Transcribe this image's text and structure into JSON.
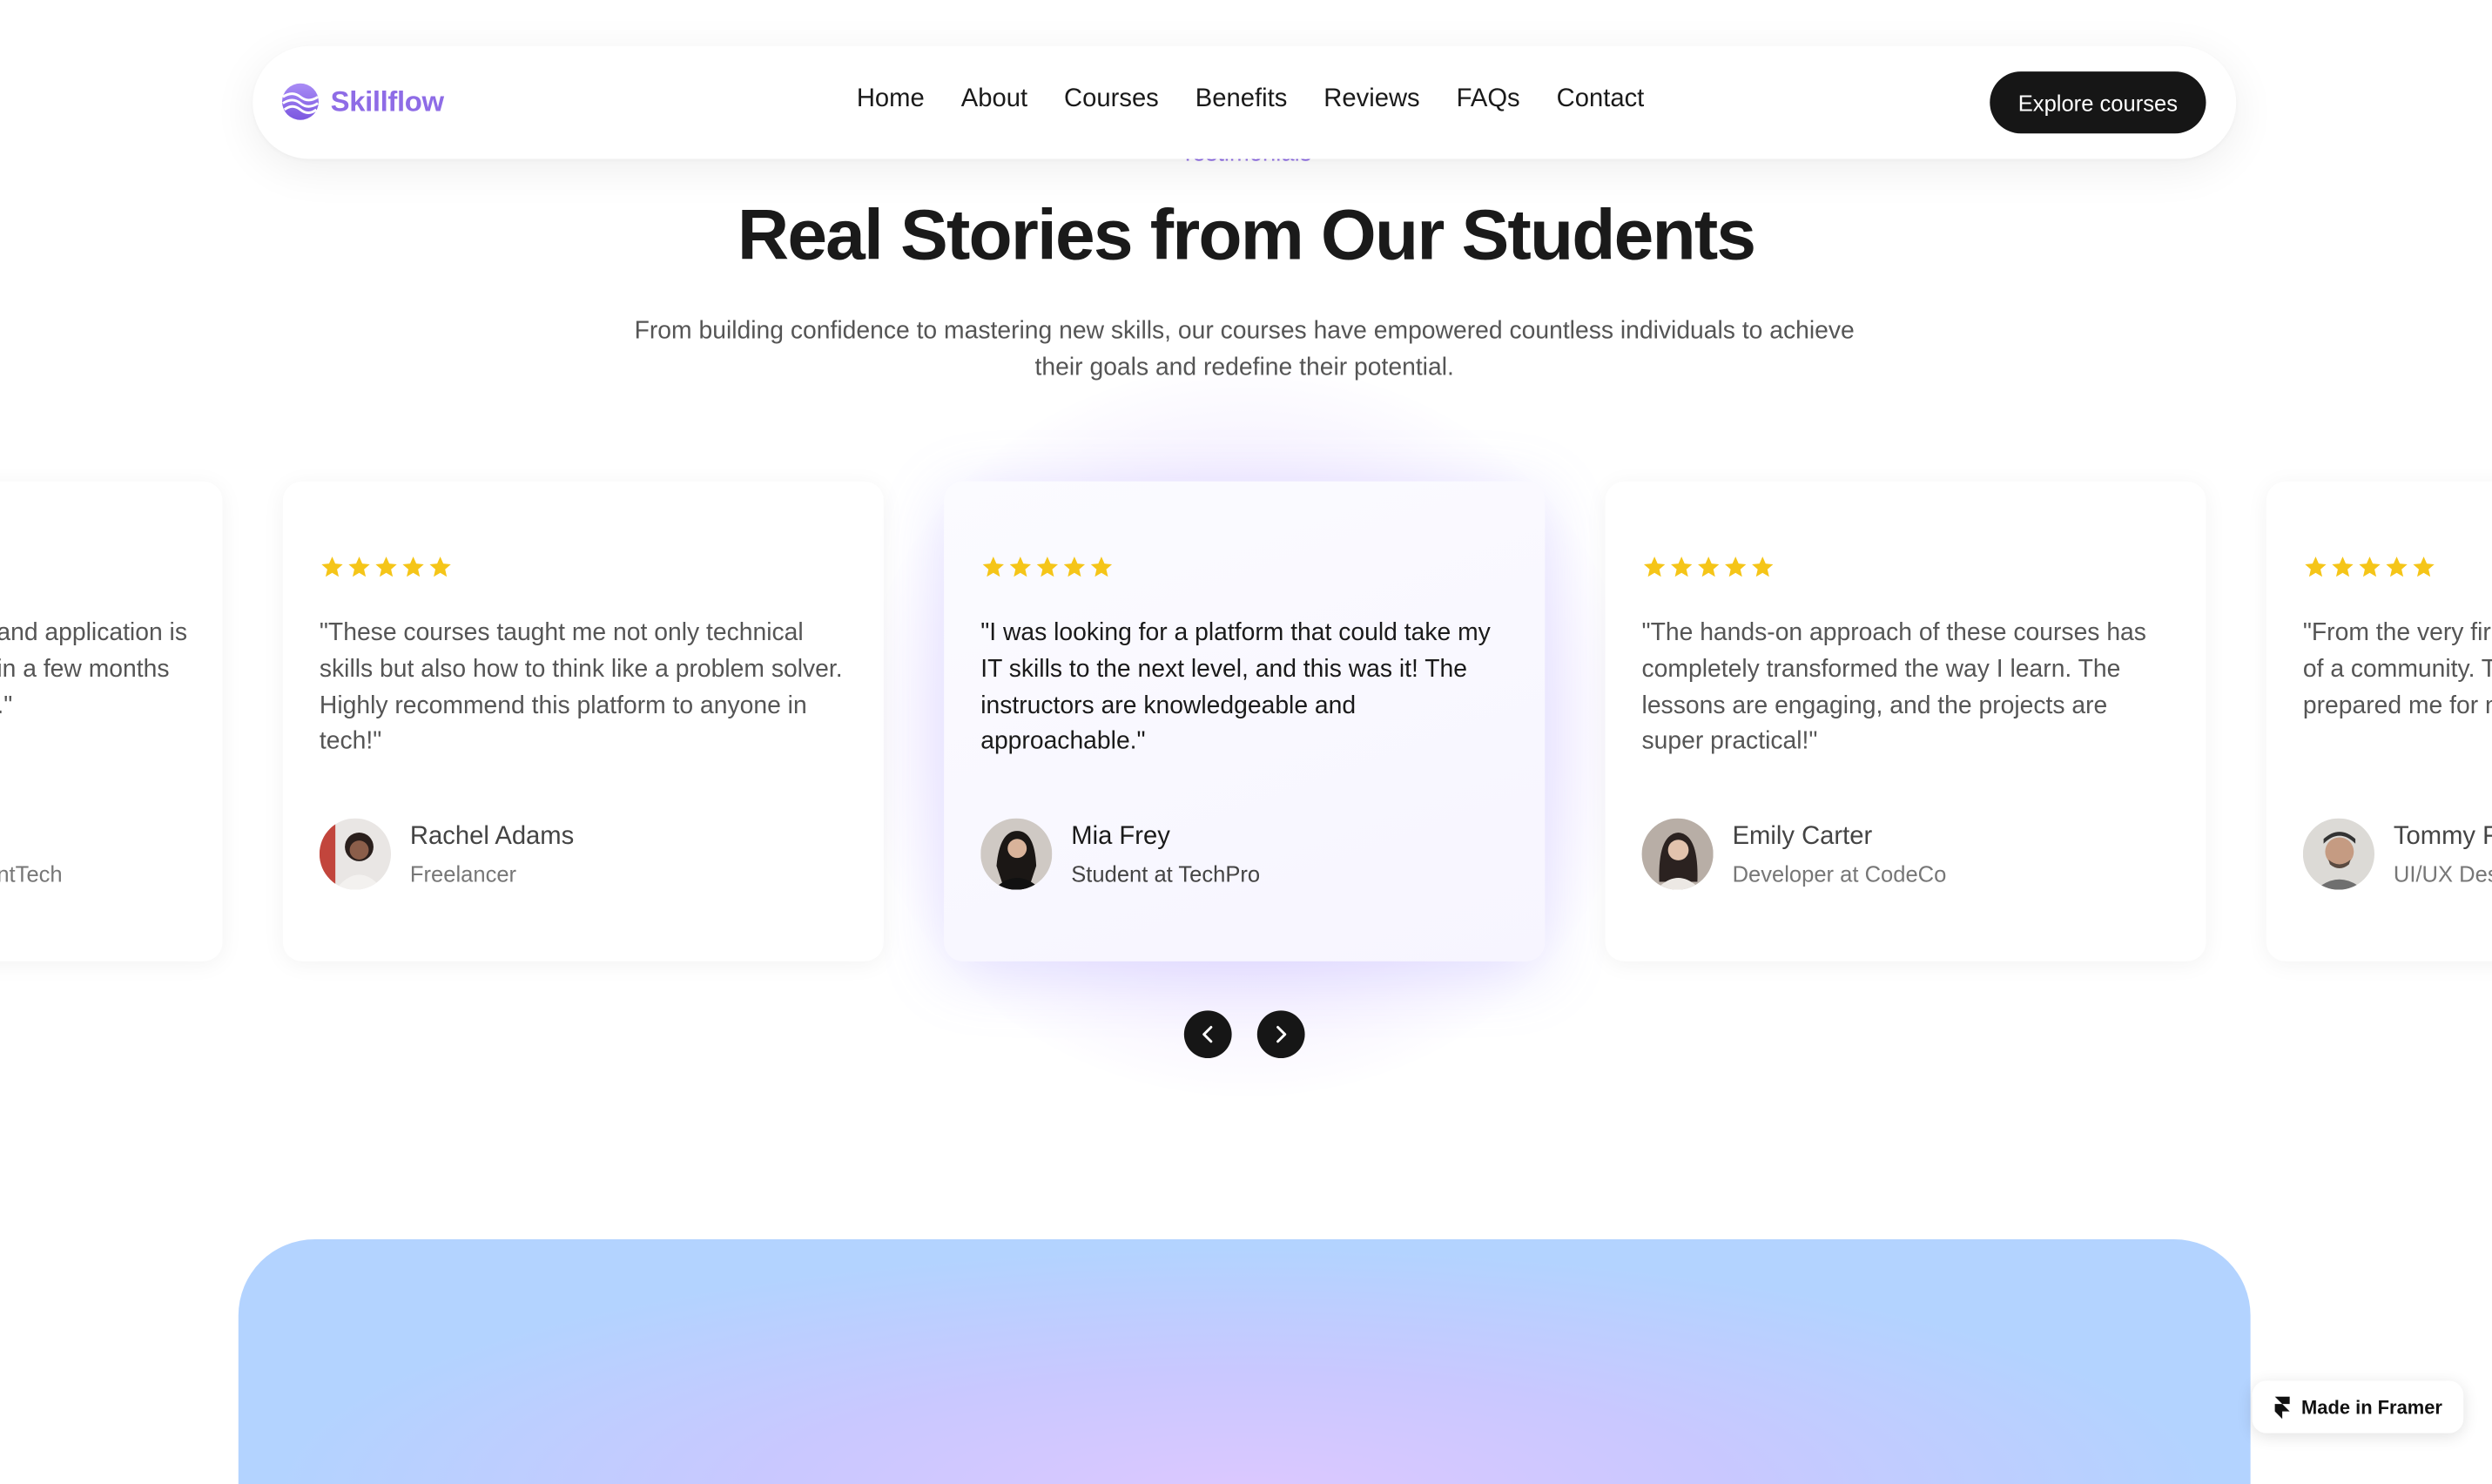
{
  "nav": {
    "brand": "Skillflow",
    "links": [
      "Home",
      "About",
      "Courses",
      "Benefits",
      "Reviews",
      "FAQs",
      "Contact"
    ],
    "cta": "Explore courses"
  },
  "section": {
    "eyebrow": "Testimonials",
    "title": "Real Stories from Our Students",
    "subtitle": "From building confidence to mastering new skills, our courses have empowered countless individuals to achieve their goals and redefine their potential."
  },
  "cards": [
    {
      "quote_visible": "and application is\n in a few months\n.\"",
      "name": "",
      "role": "ntTech",
      "rating": 5
    },
    {
      "quote": "\"These courses taught me not only technical skills but also how to think like a problem solver. Highly recommend this platform to anyone in tech!\"",
      "name": "Rachel Adams",
      "role": "Freelancer",
      "rating": 5
    },
    {
      "quote": "\"I was looking for a platform that could take my IT skills to the next level, and this was it! The instructors are knowledgeable and approachable.\"",
      "name": "Mia Frey",
      "role": "Student at TechPro",
      "rating": 5
    },
    {
      "quote": "\"The hands-on approach of these courses has completely transformed the way I learn. The lessons are engaging, and the projects are super practical!\"",
      "name": "Emily Carter",
      "role": "Developer at CodeCo",
      "rating": 5
    },
    {
      "quote": "\"From the very fir\nof a community. T\nprepared me for n",
      "name": "Tommy F",
      "role": "UI/UX Des",
      "rating": 5
    }
  ],
  "badge": {
    "label": "Made in Framer"
  },
  "colors": {
    "accent": "#8e6ce6",
    "star": "#f5c518",
    "dark": "#161616"
  }
}
